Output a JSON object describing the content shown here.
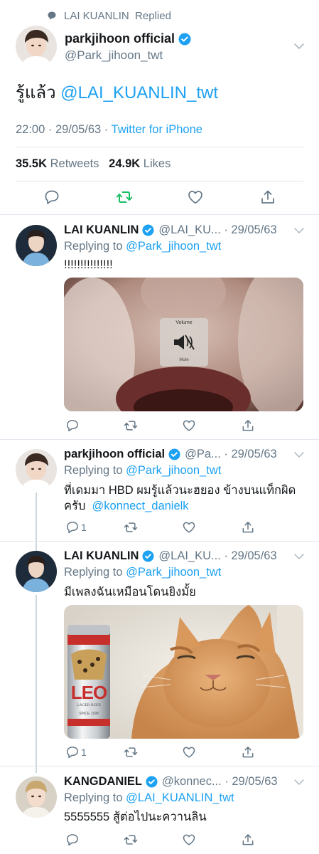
{
  "main_tweet": {
    "replied_by": "LAI KUANLIN",
    "replied_label": "Replied",
    "name": "parkjihoon official",
    "handle": "@Park_jihoon_twt",
    "text": "รู้แล้ว",
    "mention": "@LAI_KUANLIN_twt",
    "time": "22:00 · 29/05/63 · ",
    "source": "Twitter for iPhone",
    "retweets_count": "35.5K",
    "retweets_label": "Retweets",
    "likes_count": "24.9K",
    "likes_label": "Likes"
  },
  "replies": [
    {
      "name": "LAI KUANLIN",
      "handle": "@LAI_KU... · 29/05/63",
      "replying_prefix": "Replying to",
      "replying_to": "@Park_jihoon_twt",
      "text": "!!!!!!!!!!!!!!!",
      "media_label": "Volume",
      "media_sublabel": "Mute"
    },
    {
      "name": "parkjihoon official",
      "handle": "@Pa... · 29/05/63",
      "replying_prefix": "Replying to",
      "replying_to": "@Park_jihoon_twt",
      "text_line1": "ที่เดมมา HBD ผมรู้แล้วนะฮยอง ข้างบนแท็กผิด",
      "text_line2": "ครับ",
      "mention": "@konnect_danielk",
      "reply_count": "1"
    },
    {
      "name": "LAI KUANLIN",
      "handle": "@LAI_KU... · 29/05/63",
      "replying_prefix": "Replying to",
      "replying_to": "@Park_jihoon_twt",
      "text": "มีเพลงฉันเหมือนโดนยิงมั้ย",
      "media_can_brand": "LEO",
      "media_can_sub": "LAGER BEER",
      "media_can_since": "SINCE 1998",
      "reply_count": "1"
    },
    {
      "name": "KANGDANIEL",
      "handle": "@konnec... · 29/05/63",
      "replying_prefix": "Replying to",
      "replying_to": "@LAI_KUANLIN_twt",
      "text": "5555555 สู้ต่อไปนะควานลิน"
    }
  ],
  "colors": {
    "accent": "#1da1f2",
    "retweet_green": "#17bf63",
    "secondary_text": "#657786",
    "divider": "#e1e8ed"
  },
  "icons": {
    "reply": "comment-bubble-icon",
    "retweet": "retweet-icon",
    "like": "heart-icon",
    "share": "share-icon",
    "verified": "verified-badge-icon",
    "more": "chevron-down-icon"
  }
}
